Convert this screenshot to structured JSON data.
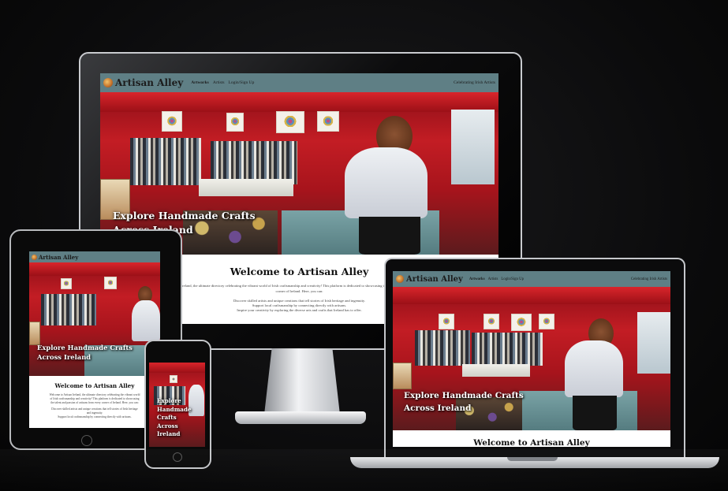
{
  "site": {
    "brand": "Artisan Alley",
    "nav": [
      "Artworks",
      "Artists",
      "Login/Sign Up"
    ],
    "active_nav": "Artworks",
    "tagline": "Celebrating Irish Artists",
    "hero_title_line1": "Explore Handmade Crafts",
    "hero_title_line2": "Across Ireland",
    "welcome_title": "Welcome to Artisan Alley",
    "welcome_p1": "Welcome to Artisan Ireland, the ultimate directory celebrating the vibrant world of Irish craftsmanship and creativity! This platform is dedicated to showcasing the talent and passion of artisans from every corner of Ireland. Here, you can:",
    "welcome_p2": "Discover skilled artists and unique creations that tell stories of Irish heritage and ingenuity.",
    "welcome_p3": "Support local craftsmanship by connecting directly with artisans.",
    "welcome_p4": "Inspire your creativity by exploring the diverse arts and crafts that Ireland has to offer."
  },
  "phone": {
    "hero_words": [
      "Explore",
      "Handmade",
      "Crafts",
      "Across",
      "Ireland"
    ]
  },
  "colors": {
    "nav_bg": "#5f7f85",
    "tent_red": "#c31d24",
    "background": "#0b0b0c"
  }
}
